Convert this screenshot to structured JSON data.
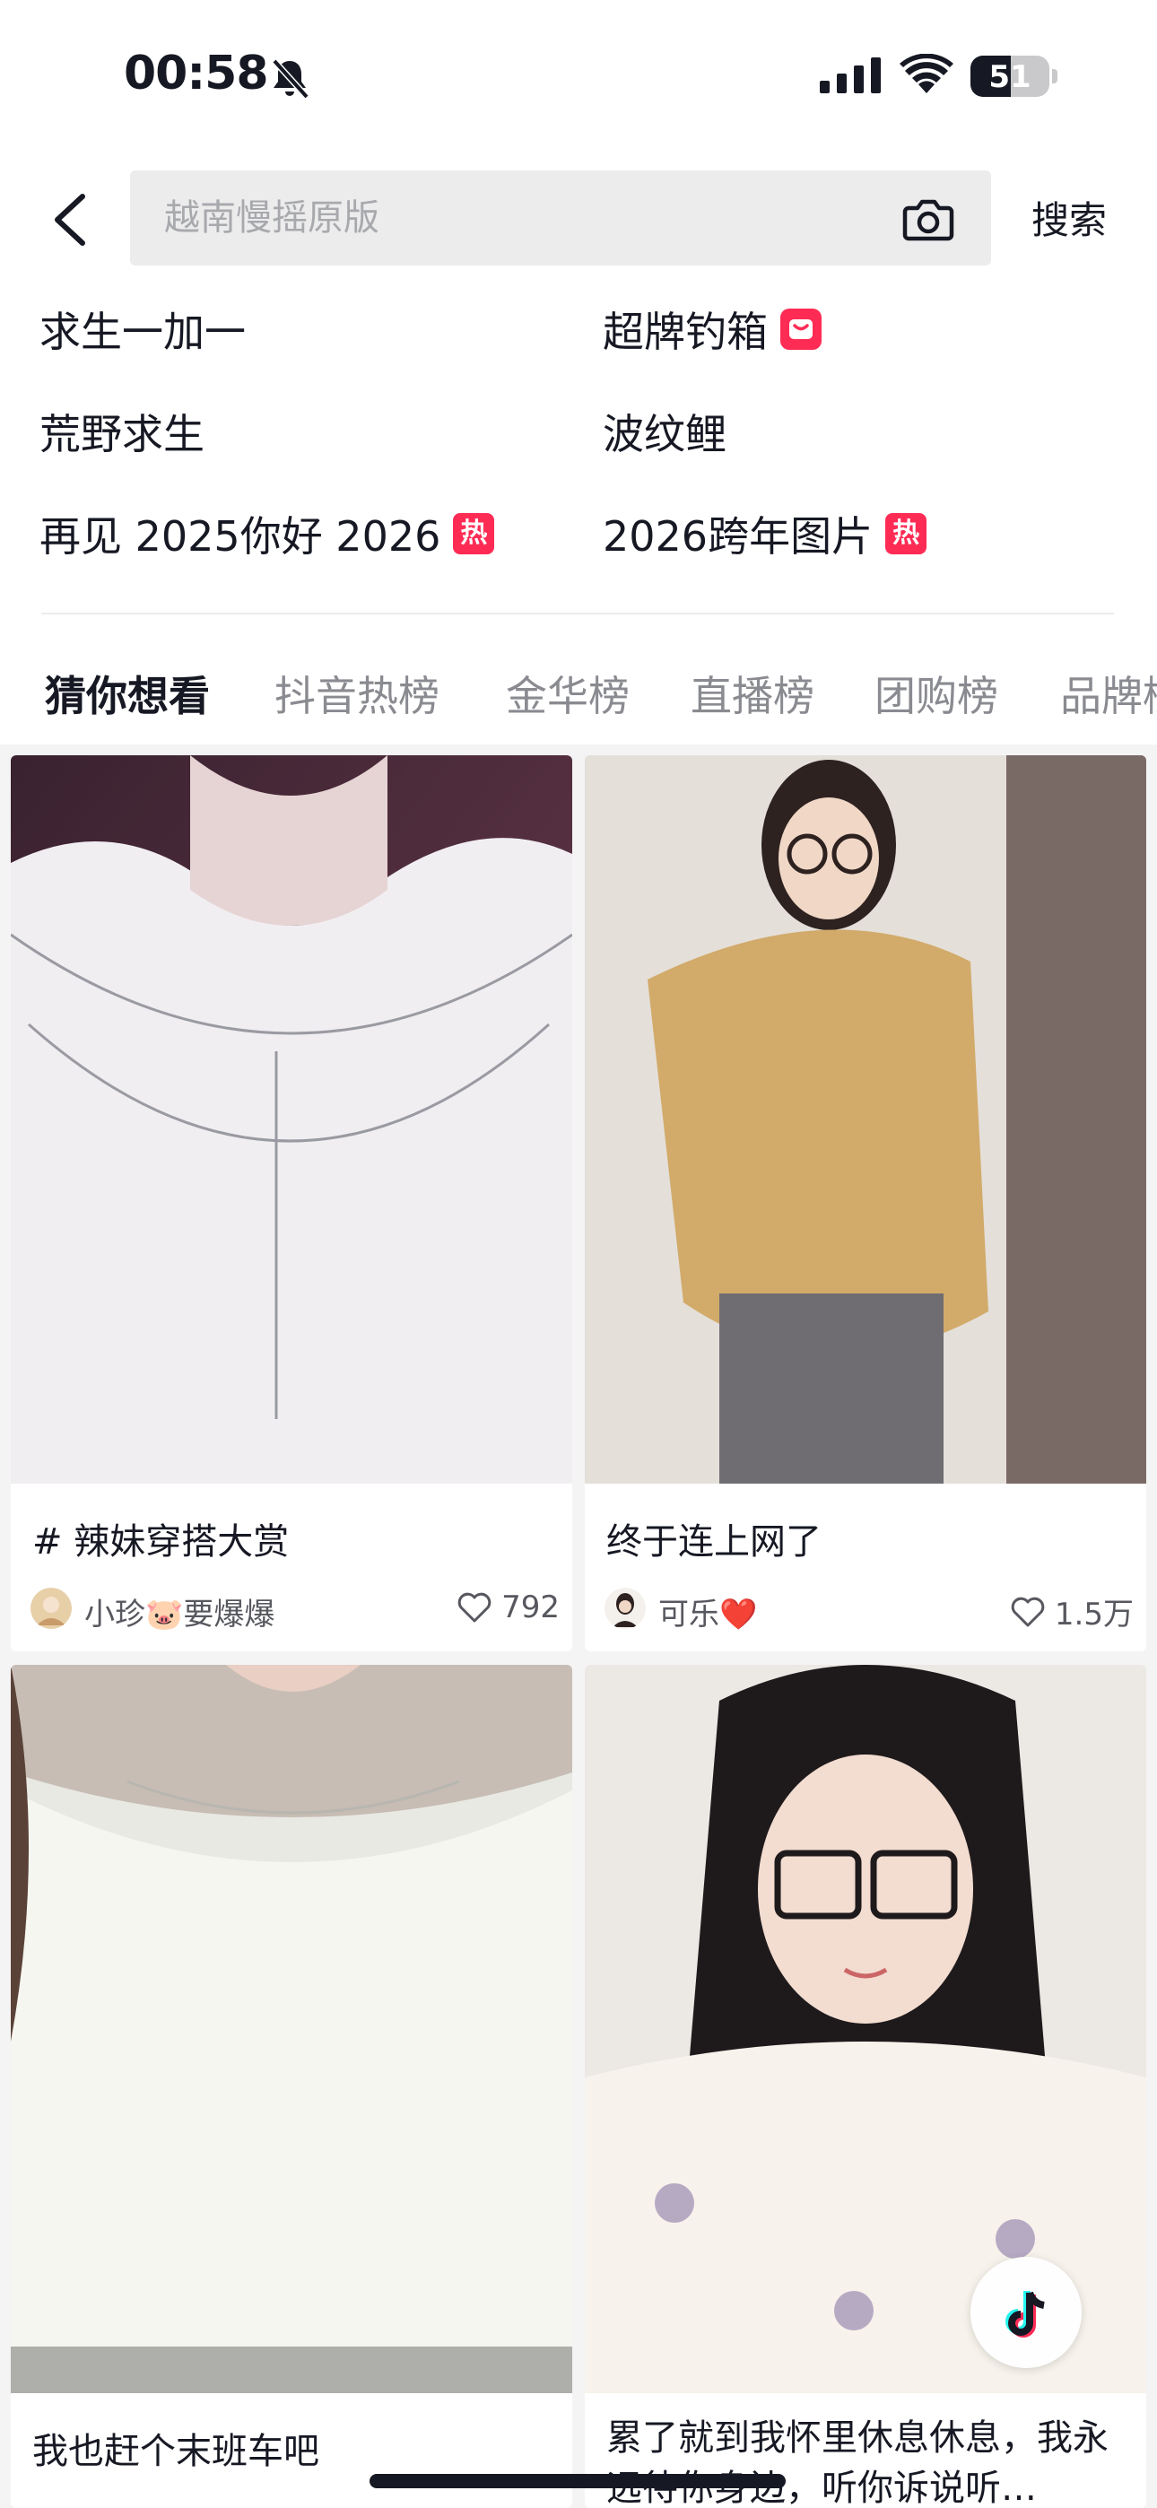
{
  "status_bar": {
    "time": "00:58",
    "battery": "51",
    "battery_level": 0.51
  },
  "search": {
    "placeholder": "越南慢摇原版",
    "button_label": "搜索"
  },
  "suggestions": [
    {
      "text": "求生一加一",
      "badge": ""
    },
    {
      "text": "超牌钓箱",
      "badge": "new"
    },
    {
      "text": "荒野求生",
      "badge": ""
    },
    {
      "text": "波纹鲤",
      "badge": ""
    },
    {
      "text": "再见 2025你好 2026",
      "badge": "热"
    },
    {
      "text": "2026跨年图片",
      "badge": "热"
    }
  ],
  "tabs": [
    "猜你想看",
    "抖音热榜",
    "金华榜",
    "直播榜",
    "团购榜",
    "品牌榜"
  ],
  "cards": [
    {
      "title": "# 辣妹穿搭大赏",
      "author": "小珍🐷要爆爆",
      "likes": "792"
    },
    {
      "title": "终于连上网了",
      "author": "可乐❤️",
      "likes": "1.5万"
    },
    {
      "title": "我也赶个末班车吧"
    },
    {
      "title": "累了就到我怀里休息休息，我永远待你身边，听你诉说听…"
    }
  ],
  "colors": {
    "accent": "#fe2c55",
    "text": "#161823",
    "secondary": "#8a8b91",
    "search_bg": "#ececed"
  },
  "icons": [
    "back-arrow-icon",
    "camera-icon",
    "heart-icon",
    "bell-slash-icon",
    "signal-icon",
    "wifi-icon",
    "tiktok-icon"
  ]
}
